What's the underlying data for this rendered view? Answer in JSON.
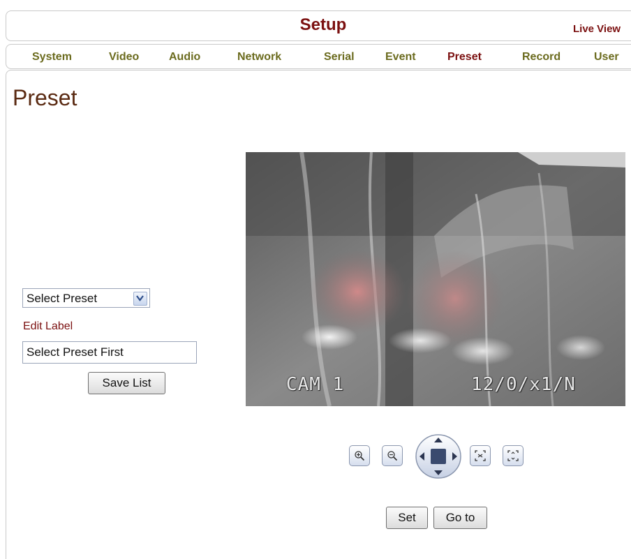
{
  "header": {
    "title": "Setup",
    "live_view": "Live View"
  },
  "nav": {
    "items": [
      {
        "label": "System"
      },
      {
        "label": "Video"
      },
      {
        "label": "Audio"
      },
      {
        "label": "Network"
      },
      {
        "label": "Serial"
      },
      {
        "label": "Event"
      },
      {
        "label": "Preset",
        "active": true
      },
      {
        "label": "Record"
      },
      {
        "label": "User"
      }
    ]
  },
  "page": {
    "title": "Preset"
  },
  "preset_panel": {
    "select_value": "Select Preset",
    "edit_label": "Edit Label",
    "label_value": "Select Preset First",
    "save_button": "Save List"
  },
  "video": {
    "osd_camera": "CAM 1",
    "osd_info": "12/0/x1/N"
  },
  "ptz": {
    "zoom_in_icon": "zoom-in-icon",
    "zoom_out_icon": "zoom-out-icon",
    "focus_near_icon": "focus-near-icon",
    "focus_far_icon": "focus-far-icon"
  },
  "actions": {
    "set": "Set",
    "goto": "Go to"
  },
  "colors": {
    "brand": "#7b1010",
    "nav_text": "#6b6b1e",
    "heading": "#5a2a12"
  }
}
